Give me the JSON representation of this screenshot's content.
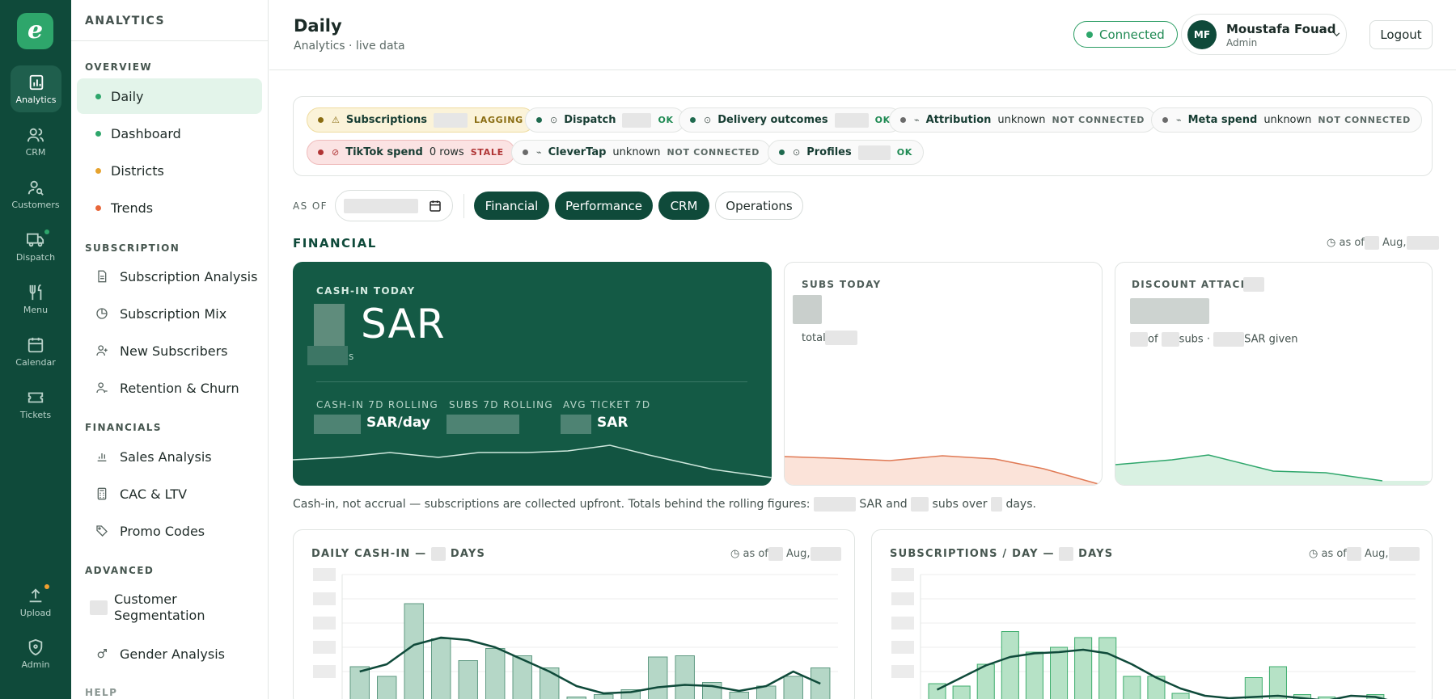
{
  "rail": {
    "items": [
      {
        "label": "Analytics"
      },
      {
        "label": "CRM"
      },
      {
        "label": "Customers"
      },
      {
        "label": "Dispatch"
      },
      {
        "label": "Menu"
      },
      {
        "label": "Calendar"
      },
      {
        "label": "Tickets"
      },
      {
        "label": "Upload"
      },
      {
        "label": "Admin"
      }
    ]
  },
  "sidebar": {
    "title": "ANALYTICS",
    "sections": [
      "OVERVIEW",
      "SUBSCRIPTION",
      "FINANCIALS",
      "ADVANCED",
      "HELP"
    ],
    "overview": [
      {
        "label": "Daily",
        "color": "#2ea66b"
      },
      {
        "label": "Dashboard",
        "color": "#2ea66b"
      },
      {
        "label": "Districts",
        "color": "#e6a32e"
      },
      {
        "label": "Trends",
        "color": "#e8673a"
      }
    ],
    "subscription": [
      "Subscription Analysis",
      "Subscription Mix",
      "New Subscribers",
      "Retention & Churn"
    ],
    "financials": [
      "Sales Analysis",
      "CAC & LTV",
      "Promo Codes"
    ],
    "advanced": [
      "Customer\nSegmentation",
      "Gender Analysis"
    ]
  },
  "header": {
    "title": "Daily",
    "subtitle": "Analytics · live data",
    "connected": "Connected",
    "user_initials": "MF",
    "user_name": "Moustafa Fouad",
    "user_role": "Admin",
    "logout": "Logout"
  },
  "status": {
    "chips": [
      {
        "name": "Subscriptions",
        "meta": "",
        "state": "LAGGING"
      },
      {
        "name": "Dispatch",
        "meta": "",
        "state": "OK"
      },
      {
        "name": "Delivery outcomes",
        "meta": "",
        "state": "OK"
      },
      {
        "name": "Attribution",
        "meta": "unknown",
        "state": "NOT CONNECTED"
      },
      {
        "name": "Meta spend",
        "meta": "unknown",
        "state": "NOT CONNECTED"
      },
      {
        "name": "TikTok spend",
        "meta": "0 rows",
        "state": "STALE"
      },
      {
        "name": "CleverTap",
        "meta": "unknown",
        "state": "NOT CONNECTED"
      },
      {
        "name": "Profiles",
        "meta": "",
        "state": "OK"
      }
    ]
  },
  "controls": {
    "as_of_label": "AS OF",
    "tabs": [
      "Financial",
      "Performance",
      "CRM",
      "Operations"
    ]
  },
  "financial": {
    "heading": "FINANCIAL",
    "as_of_prefix": "as of",
    "as_of_month": "Aug,",
    "cash_label": "CASH-IN TODAY",
    "cash_unit": "SAR",
    "cash_suffix": "s",
    "roll_labels": [
      "CASH-IN 7D ROLLING",
      "SUBS 7D ROLLING",
      "AVG TICKET 7D"
    ],
    "roll_units": [
      "SAR/day",
      "",
      "SAR"
    ],
    "subs_label": "SUBS TODAY",
    "subs_total": "total",
    "discount_label": "DISCOUNT ATTACH",
    "discount_of": "of",
    "discount_subs": "subs ·",
    "discount_given": "SAR given",
    "footnote_a": "Cash-in, not accrual — subscriptions are collected upfront. Totals behind the rolling figures:",
    "footnote_b": "SAR and",
    "footnote_c": "subs over",
    "footnote_d": "days."
  },
  "colors": {
    "brand": "#0f4a3a",
    "accent": "#2ea66b",
    "bar_fill": "#b5d7c7",
    "bar_fill2": "#b6e2c6"
  },
  "charts": [
    {
      "title_a": "DAILY CASH-IN —",
      "title_b": "DAYS",
      "as_of": "as of",
      "month": "Aug,"
    },
    {
      "title_a": "SUBSCRIPTIONS / DAY —",
      "title_b": "DAYS",
      "as_of": "as of",
      "month": "Aug,"
    }
  ],
  "chart_data": [
    {
      "type": "bar",
      "title": "DAILY CASH-IN — DAYS",
      "values": [
        0.34,
        0.26,
        0.86,
        0.57,
        0.39,
        0.49,
        0.43,
        0.33,
        0.09,
        0.11,
        0.15,
        0.42,
        0.43,
        0.21,
        0.13,
        0.18,
        0.26,
        0.33
      ],
      "trend": [
        0.3,
        0.36,
        0.52,
        0.58,
        0.56,
        0.5,
        0.4,
        0.3,
        0.18,
        0.12,
        0.13,
        0.17,
        0.19,
        0.18,
        0.14,
        0.18,
        0.3,
        0.2
      ]
    },
    {
      "type": "bar",
      "title": "SUBSCRIPTIONS / DAY — DAYS",
      "values": [
        0.2,
        0.18,
        0.36,
        0.63,
        0.46,
        0.5,
        0.58,
        0.58,
        0.26,
        0.26,
        0.12,
        0.06,
        0.05,
        0.25,
        0.34,
        0.11,
        0.09,
        0.07,
        0.11,
        0.07
      ],
      "trend": [
        0.15,
        0.25,
        0.35,
        0.42,
        0.45,
        0.46,
        0.48,
        0.45,
        0.36,
        0.25,
        0.16,
        0.1,
        0.08,
        0.09,
        0.1,
        0.08,
        0.06,
        0.1,
        0.09,
        0.04
      ]
    }
  ]
}
